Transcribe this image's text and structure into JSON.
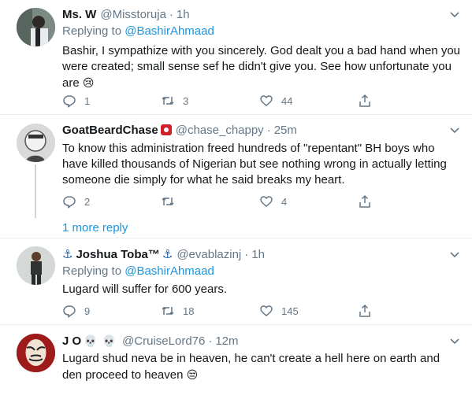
{
  "tweets": [
    {
      "name": "Ms. W",
      "handle": "@Misstoruja",
      "time": "1h",
      "replying_label": "Replying to",
      "replying_to": "@BashirAhmaad",
      "text": "Bashir, I sympathize with you sincerely. God dealt you a bad hand when you were created; small sense sef he didn't give you. See how unfortunate you are",
      "text_emoji": "😢",
      "replies": "1",
      "retweets": "3",
      "likes": "44"
    },
    {
      "name": "GoatBeardChase",
      "handle": "@chase_chappy",
      "time": "25m",
      "text": "To know this administration freed hundreds of \"repentant\" BH boys who have killed thousands of Nigerian but see nothing wrong in actually letting someone die simply for what he said breaks my heart.",
      "replies": "2",
      "retweets": "",
      "likes": "4"
    },
    {
      "name_prefix": "⚓",
      "name": "Joshua Toba™",
      "name_suffix": "⚓",
      "handle": "@evablazinj",
      "time": "1h",
      "replying_label": "Replying to",
      "replying_to": "@BashirAhmaad",
      "text": "Lugard will suffer for 600 years.",
      "replies": "9",
      "retweets": "18",
      "likes": "145"
    },
    {
      "name": "J O",
      "name_emoji_1": "💀",
      "name_emoji_2": "💀",
      "handle": "@CruiseLord76",
      "time": "12m",
      "text": "Lugard shud neva be in heaven, he can't create a hell here on earth and den proceed to heaven",
      "text_emoji": "😒"
    }
  ],
  "more_replies": "1 more reply",
  "separator": "·",
  "colors": {
    "link": "#1b95e0",
    "muted": "#657786",
    "text": "#14171a",
    "border": "#e6ecf0"
  }
}
